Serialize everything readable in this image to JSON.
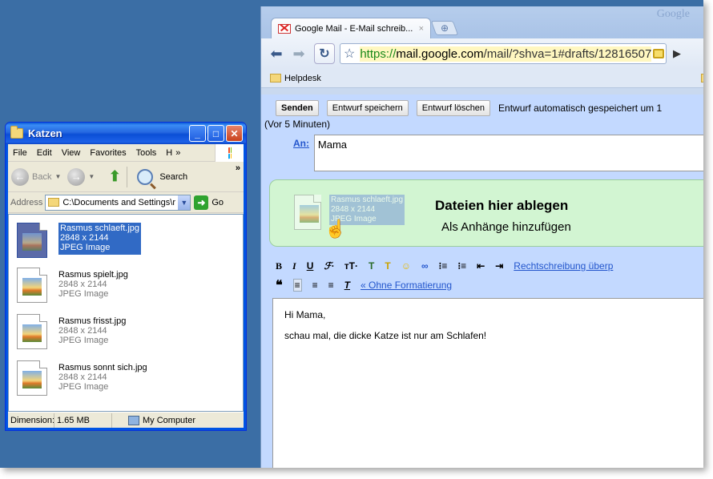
{
  "explorer": {
    "title": "Katzen",
    "menu": [
      "File",
      "Edit",
      "View",
      "Favorites",
      "Tools",
      "H"
    ],
    "menu_more": "»",
    "back_label": "Back",
    "search_label": "Search",
    "address_label": "Address",
    "address_value": "C:\\Documents and Settings\\r",
    "go_label": "Go",
    "files": [
      {
        "name": "Rasmus schlaeft.jpg",
        "dims": "2848 x 2144",
        "type": "JPEG Image",
        "selected": true
      },
      {
        "name": "Rasmus spielt.jpg",
        "dims": "2848 x 2144",
        "type": "JPEG Image",
        "selected": false
      },
      {
        "name": "Rasmus frisst.jpg",
        "dims": "2848 x 2144",
        "type": "JPEG Image",
        "selected": false
      },
      {
        "name": "Rasmus sonnt sich.jpg",
        "dims": "2848 x 2144",
        "type": "JPEG Image",
        "selected": false
      }
    ],
    "status": {
      "dimensions": "Dimension:",
      "size": "1.65 MB",
      "location": "My Computer"
    }
  },
  "browser": {
    "watermark": "Google",
    "tab_title": "Google Mail - E-Mail schreib...",
    "tab_close": "×",
    "url_https": "https://",
    "url_domain": "mail.google.com",
    "url_path": "/mail/?shva=1#drafts/12816507",
    "bookmark": "Helpdesk"
  },
  "compose": {
    "send": "Senden",
    "save_draft": "Entwurf speichern",
    "delete_draft": "Entwurf löschen",
    "autosave": "Entwurf automatisch gespeichert um 1",
    "autosave_ago": "(Vor 5 Minuten)",
    "to_label": "An:",
    "to_value": "Mama",
    "drop_title": "Dateien hier ablegen",
    "drop_subtitle": "Als Anhänge hinzufügen",
    "spellcheck": "Rechtschreibung überp",
    "plain_text": "« Ohne Formatierung",
    "body_line1": "Hi Mama,",
    "body_line2": "schau mal, die dicke Katze ist nur am Schlafen!"
  }
}
